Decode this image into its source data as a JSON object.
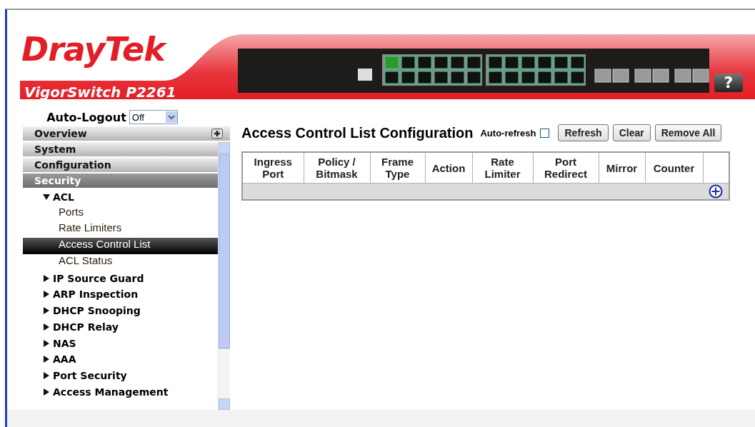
{
  "header": {
    "brand": "DrayTek",
    "model": "VigorSwitch P2261",
    "help": "?"
  },
  "sidebar": {
    "auto_logout": {
      "label": "Auto-Logout",
      "value": "Off"
    },
    "sections": [
      {
        "label": "Overview",
        "selected": false
      },
      {
        "label": "System",
        "selected": false
      },
      {
        "label": "Configuration",
        "selected": false
      },
      {
        "label": "Security",
        "selected": true
      }
    ],
    "tree": [
      {
        "label": "ACL",
        "expanded": true,
        "children": [
          {
            "label": "Ports",
            "selected": false
          },
          {
            "label": "Rate Limiters",
            "selected": false
          },
          {
            "label": "Access Control List",
            "selected": true
          },
          {
            "label": "ACL Status",
            "selected": false
          }
        ]
      },
      {
        "label": "IP Source Guard",
        "expanded": false
      },
      {
        "label": "ARP Inspection",
        "expanded": false
      },
      {
        "label": "DHCP Snooping",
        "expanded": false
      },
      {
        "label": "DHCP Relay",
        "expanded": false
      },
      {
        "label": "NAS",
        "expanded": false
      },
      {
        "label": "AAA",
        "expanded": false
      },
      {
        "label": "Port Security",
        "expanded": false
      },
      {
        "label": "Access Management",
        "expanded": false
      }
    ]
  },
  "main": {
    "title": "Access Control List Configuration",
    "auto_refresh": {
      "label": "Auto-refresh",
      "checked": false
    },
    "buttons": [
      "Refresh",
      "Clear",
      "Remove All"
    ],
    "table": {
      "columns": [
        "Ingress Port",
        "Policy / Bitmask",
        "Frame Type",
        "Action",
        "Rate Limiter",
        "Port Redirect",
        "Mirror",
        "Counter"
      ]
    }
  }
}
